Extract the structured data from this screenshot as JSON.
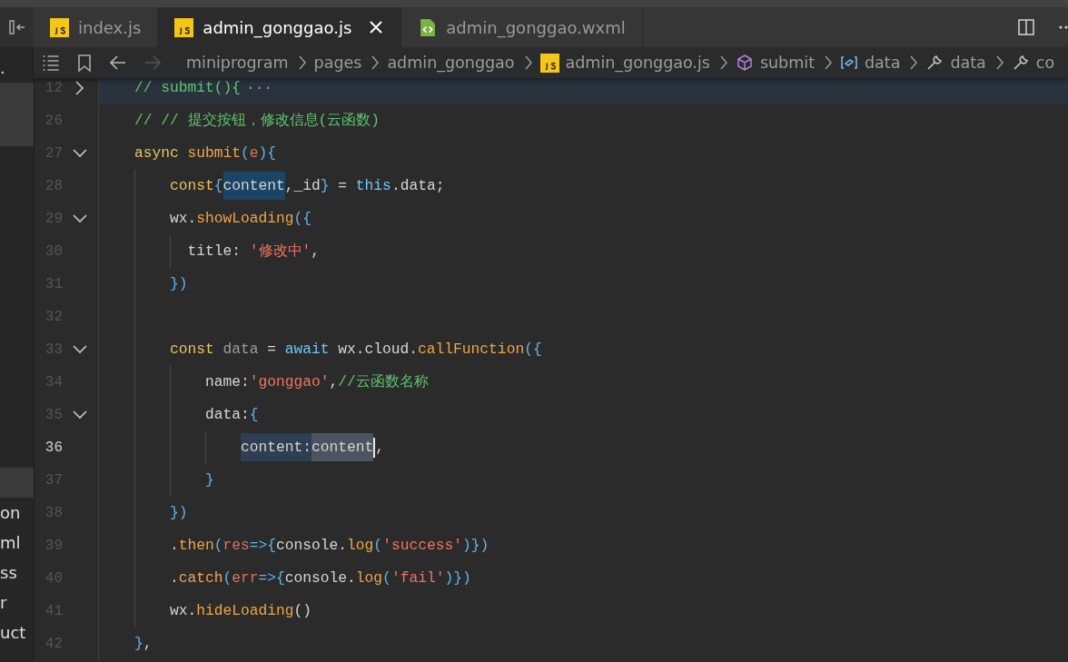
{
  "sidebar": {
    "top_items": [
      {
        "label": ".",
        "selected": false
      },
      {
        "selected": true
      }
    ],
    "bottom_items": [
      {
        "selected": true
      },
      {
        "label": "on",
        "selected": false
      },
      {
        "label": "ml",
        "selected": false
      },
      {
        "label": "ss",
        "selected": false
      },
      {
        "label": "r",
        "selected": false
      },
      {
        "label": "uct",
        "selected": false
      }
    ]
  },
  "tabs": [
    {
      "label": "index.js",
      "kind": "js",
      "selected": false
    },
    {
      "label": "admin_gonggao.js",
      "kind": "js",
      "selected": true
    },
    {
      "label": "admin_gonggao.wxml",
      "kind": "markup",
      "selected": false
    }
  ],
  "breadcrumbs": [
    {
      "label": "miniprogram",
      "kind": "folder"
    },
    {
      "label": "pages",
      "kind": "folder"
    },
    {
      "label": "admin_gonggao",
      "kind": "folder"
    },
    {
      "label": "admin_gonggao.js",
      "kind": "js"
    },
    {
      "label": "submit",
      "kind": "method"
    },
    {
      "label": "data",
      "kind": "variable"
    },
    {
      "label": "data",
      "kind": "property"
    },
    {
      "label": "co",
      "kind": "property"
    }
  ],
  "lines": [
    {
      "number": "12",
      "foldable": true,
      "collapsed": true,
      "current": false,
      "tokens": [
        {
          "kind": "comment",
          "text": "    // submit(){"
        },
        {
          "kind": "ellipsis",
          "text": "···"
        }
      ]
    },
    {
      "number": "26",
      "foldable": false,
      "collapsed": false,
      "current": false,
      "tokens": [
        {
          "kind": "comment",
          "text": "    // // 提交按钮，修改信息(云函数)"
        }
      ]
    },
    {
      "number": "27",
      "foldable": true,
      "collapsed": false,
      "current": false,
      "tokens": [
        {
          "kind": "keyword",
          "text": "    async "
        },
        {
          "kind": "function",
          "text": "submit"
        },
        {
          "kind": "brace",
          "text": "("
        },
        {
          "kind": "param",
          "text": "e"
        },
        {
          "kind": "brace",
          "text": "){"
        }
      ]
    },
    {
      "number": "28",
      "foldable": false,
      "collapsed": false,
      "current": false,
      "tokens": [
        {
          "kind": "keyword",
          "text": "        const",
          "highlighted": false,
          "selected": false
        },
        {
          "kind": "brace",
          "text": "{",
          "highlighted": false,
          "selected": false
        },
        {
          "kind": "plain",
          "text": "content",
          "highlighted": true,
          "selected": false
        },
        {
          "kind": "plain",
          "text": ",_id",
          "highlighted": false,
          "selected": false
        },
        {
          "kind": "brace",
          "text": "}",
          "highlighted": false,
          "selected": false
        },
        {
          "kind": "plain",
          "text": " = ",
          "highlighted": false,
          "selected": false
        },
        {
          "kind": "special",
          "text": "this",
          "highlighted": false,
          "selected": false
        },
        {
          "kind": "plain",
          "text": ".data;",
          "highlighted": false,
          "selected": false
        }
      ]
    },
    {
      "number": "29",
      "foldable": true,
      "collapsed": false,
      "current": false,
      "tokens": [
        {
          "kind": "plain",
          "text": "        wx."
        },
        {
          "kind": "function",
          "text": "showLoading"
        },
        {
          "kind": "brace",
          "text": "({"
        }
      ]
    },
    {
      "number": "30",
      "foldable": false,
      "collapsed": false,
      "current": false,
      "tokens": [
        {
          "kind": "plain",
          "text": "          title: "
        },
        {
          "kind": "string",
          "text": "'修改中'"
        },
        {
          "kind": "plain",
          "text": ","
        }
      ]
    },
    {
      "number": "31",
      "foldable": false,
      "collapsed": false,
      "current": false,
      "tokens": [
        {
          "kind": "brace",
          "text": "        })"
        }
      ]
    },
    {
      "number": "32",
      "foldable": false,
      "collapsed": false,
      "current": false
    },
    {
      "number": "33",
      "foldable": true,
      "collapsed": false,
      "current": false,
      "tokens": [
        {
          "kind": "keyword",
          "text": "        const"
        },
        {
          "kind": "variable",
          "text": " data"
        },
        {
          "kind": "plain",
          "text": " = "
        },
        {
          "kind": "special",
          "text": "await"
        },
        {
          "kind": "plain",
          "text": " wx.cloud."
        },
        {
          "kind": "function",
          "text": "callFunction"
        },
        {
          "kind": "brace",
          "text": "({"
        }
      ]
    },
    {
      "number": "34",
      "foldable": false,
      "collapsed": false,
      "current": false,
      "tokens": [
        {
          "kind": "plain",
          "text": "            name:"
        },
        {
          "kind": "string",
          "text": "'gonggao'"
        },
        {
          "kind": "plain",
          "text": ","
        },
        {
          "kind": "comment",
          "text": "//云函数名称"
        }
      ]
    },
    {
      "number": "35",
      "foldable": true,
      "collapsed": false,
      "current": false,
      "tokens": [
        {
          "kind": "plain",
          "text": "            data:"
        },
        {
          "kind": "brace",
          "text": "{"
        }
      ]
    },
    {
      "number": "36",
      "foldable": false,
      "collapsed": false,
      "current": true,
      "tokens": [
        {
          "kind": "plain",
          "text": "                content:",
          "highlighted": true,
          "selected": false,
          "caret": false
        },
        {
          "kind": "plain",
          "text": "content",
          "highlighted": false,
          "selected": true,
          "caret": true
        },
        {
          "kind": "plain",
          "text": ",",
          "highlighted": false,
          "selected": false,
          "caret": false
        }
      ]
    },
    {
      "number": "37",
      "foldable": false,
      "collapsed": false,
      "current": false,
      "tokens": [
        {
          "kind": "brace",
          "text": "            }"
        }
      ]
    },
    {
      "number": "38",
      "foldable": false,
      "collapsed": false,
      "current": false,
      "tokens": [
        {
          "kind": "brace",
          "text": "        })"
        }
      ]
    },
    {
      "number": "39",
      "foldable": false,
      "collapsed": false,
      "current": false,
      "tokens": [
        {
          "kind": "plain",
          "text": "        ."
        },
        {
          "kind": "function",
          "text": "then"
        },
        {
          "kind": "brace",
          "text": "("
        },
        {
          "kind": "param",
          "text": "res"
        },
        {
          "kind": "brace",
          "text": "=>{"
        },
        {
          "kind": "plain",
          "text": "console."
        },
        {
          "kind": "function",
          "text": "log"
        },
        {
          "kind": "brace",
          "text": "("
        },
        {
          "kind": "string",
          "text": "'success'"
        },
        {
          "kind": "brace",
          "text": ")})"
        }
      ]
    },
    {
      "number": "40",
      "foldable": false,
      "collapsed": false,
      "current": false,
      "tokens": [
        {
          "kind": "plain",
          "text": "        ."
        },
        {
          "kind": "function",
          "text": "catch"
        },
        {
          "kind": "brace",
          "text": "("
        },
        {
          "kind": "param",
          "text": "err"
        },
        {
          "kind": "brace",
          "text": "=>{"
        },
        {
          "kind": "plain",
          "text": "console."
        },
        {
          "kind": "function",
          "text": "log"
        },
        {
          "kind": "brace",
          "text": "("
        },
        {
          "kind": "string",
          "text": "'fail'"
        },
        {
          "kind": "brace",
          "text": ")})"
        }
      ]
    },
    {
      "number": "41",
      "foldable": false,
      "collapsed": false,
      "current": false,
      "tokens": [
        {
          "kind": "plain",
          "text": "        wx."
        },
        {
          "kind": "function",
          "text": "hideLoading"
        },
        {
          "kind": "plain",
          "text": "()"
        }
      ]
    },
    {
      "number": "42",
      "foldable": false,
      "collapsed": false,
      "current": false,
      "tokens": [
        {
          "kind": "brace",
          "text": "    }"
        },
        {
          "kind": "plain",
          "text": ","
        }
      ]
    }
  ]
}
